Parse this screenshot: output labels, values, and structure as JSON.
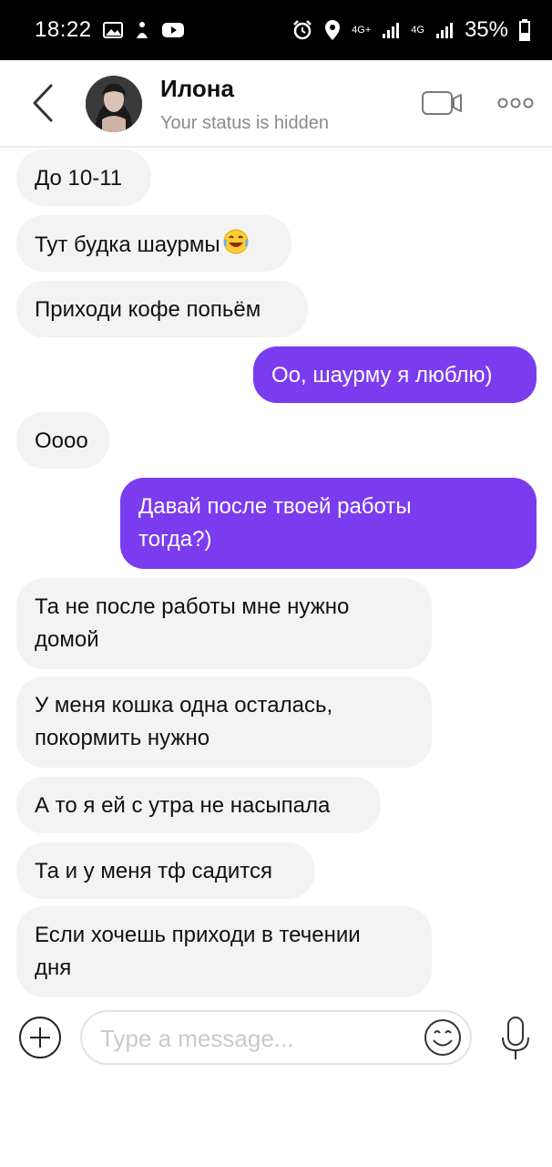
{
  "status_bar": {
    "time": "18:22",
    "net_1": "4G+",
    "net_2": "4G",
    "battery": "35%"
  },
  "header": {
    "name": "Илона",
    "status": "Your status is hidden"
  },
  "messages": [
    {
      "dir": "in",
      "text": "До 10-11"
    },
    {
      "dir": "in",
      "text": "Тут будка шаурмы",
      "emoji": "laughing-face"
    },
    {
      "dir": "in",
      "text": "Приходи кофе попьём"
    },
    {
      "dir": "out",
      "text": "Оо, шаурму я люблю)"
    },
    {
      "dir": "in",
      "text": "Оооо"
    },
    {
      "dir": "out",
      "line1": "Давай после твоей работы",
      "line2": "тогда?)"
    },
    {
      "dir": "in",
      "line1": "Та не после работы мне нужно",
      "line2": "домой"
    },
    {
      "dir": "in",
      "line1": "У меня кошка одна осталась,",
      "line2": "покормить нужно"
    },
    {
      "dir": "in",
      "text": "А то я ей с утра не насыпала"
    },
    {
      "dir": "in",
      "text": "Та и у меня тф садится"
    },
    {
      "dir": "in",
      "line1": "Если хочешь приходи в течении",
      "line2": "дня"
    }
  ],
  "composer": {
    "placeholder": "Type a message..."
  },
  "colors": {
    "outgoing_bubble": "#7b3cf0",
    "incoming_bubble": "#f3f3f3"
  }
}
